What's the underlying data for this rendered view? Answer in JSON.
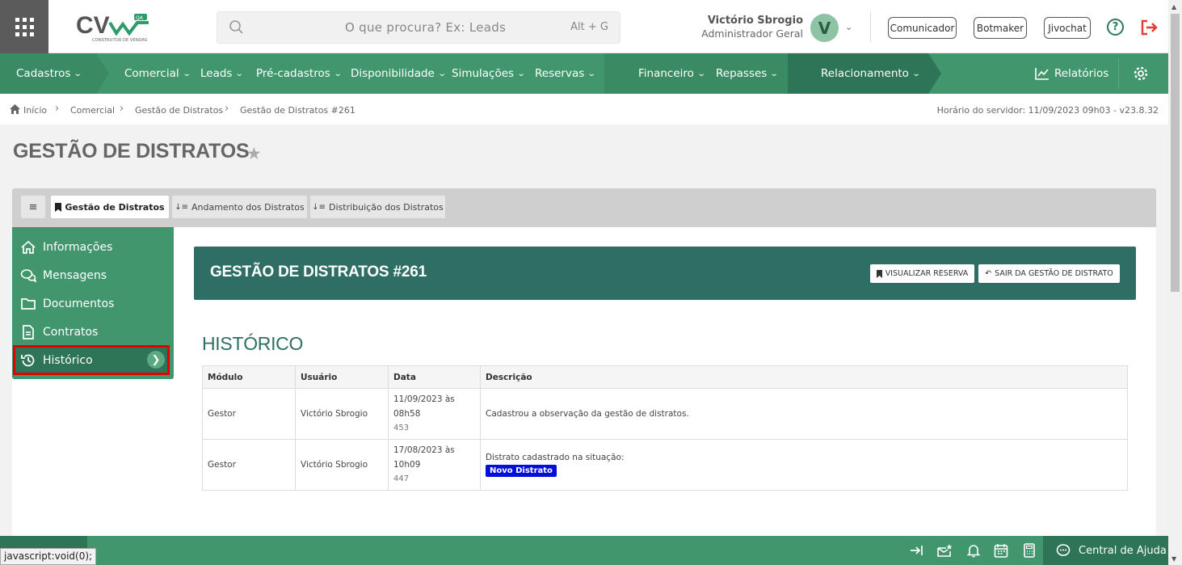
{
  "search": {
    "placeholder": "O que procura? Ex: Leads",
    "shortcut": "Alt + G"
  },
  "logo": {
    "brand": "CV",
    "badge": "QA",
    "tagline": "CONSTRUTOR DE VENDAS"
  },
  "user": {
    "name": "Victório Sbrogio",
    "role": "Administrador Geral",
    "initial": "V"
  },
  "top_buttons": [
    "Comunicador",
    "Botmaker",
    "Jivochat"
  ],
  "nav": {
    "items": [
      "Cadastros",
      "Comercial",
      "Leads",
      "Pré-cadastros",
      "Disponibilidade",
      "Simulações",
      "Reservas",
      "Financeiro",
      "Repasses",
      "Relacionamento"
    ],
    "reports": "Relatórios"
  },
  "breadcrumb": [
    "Início",
    "Comercial",
    "Gestão de Distratos",
    "Gestão de Distratos #261"
  ],
  "server_time": "Horário do servidor: 11/09/2023 09h03 - v23.8.32",
  "page_title": "GESTÃO DE DISTRATOS",
  "tabs": [
    {
      "label": "Gestão de Distratos"
    },
    {
      "label": "Andamento dos Distratos"
    },
    {
      "label": "Distribuição dos Distratos"
    }
  ],
  "sidebar": {
    "items": [
      {
        "label": "Informações",
        "icon": "home-icon"
      },
      {
        "label": "Mensagens",
        "icon": "chat-icon"
      },
      {
        "label": "Documentos",
        "icon": "folder-icon"
      },
      {
        "label": "Contratos",
        "icon": "document-icon"
      },
      {
        "label": "Histórico",
        "icon": "history-icon"
      }
    ]
  },
  "header": {
    "title": "GESTÃO DE DISTRATOS #261",
    "btn_reserva": "VISUALIZAR RESERVA",
    "btn_sair": "SAIR DA GESTÃO DE DISTRATO"
  },
  "history": {
    "title": "HISTÓRICO",
    "columns": [
      "Módulo",
      "Usuário",
      "Data",
      "Descrição"
    ],
    "rows": [
      {
        "modulo": "Gestor",
        "usuario": "Victório Sbrogio",
        "data": "11/09/2023 às",
        "hora": "08h58",
        "id": "453",
        "descricao": "Cadastrou a observação da gestão de distratos.",
        "badge": ""
      },
      {
        "modulo": "Gestor",
        "usuario": "Victório Sbrogio",
        "data": "17/08/2023 às",
        "hora": "10h09",
        "id": "447",
        "descricao": "Distrato cadastrado na situação:",
        "badge": "Novo Distrato"
      }
    ]
  },
  "footer": {
    "help": "Central de Ajuda",
    "status_text": "javascript:void(0);"
  },
  "colors": {
    "green": "#41966e",
    "dark_green": "#2e7456",
    "header_teal": "#2f6e64",
    "badge_blue": "#0010d8",
    "highlight_red": "#e10000"
  }
}
